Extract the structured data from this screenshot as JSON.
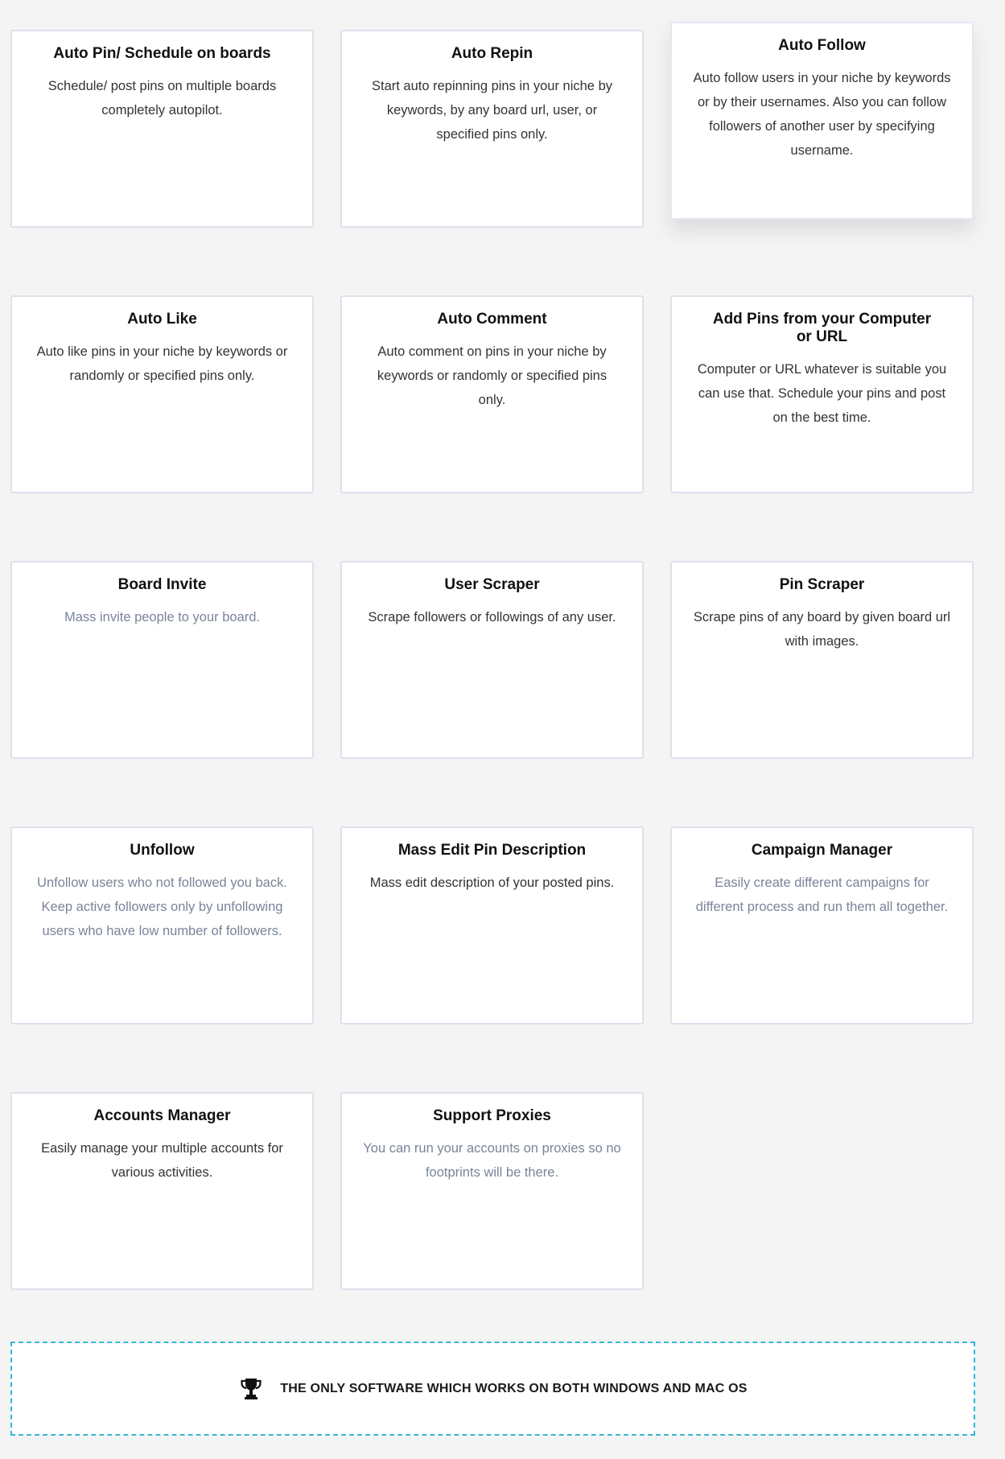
{
  "features": [
    {
      "title": "Auto Pin/ Schedule on boards",
      "description": "Schedule/ post pins on multiple boards completely autopilot."
    },
    {
      "title": "Auto Repin",
      "description": "Start auto repinning pins in your niche by keywords, by any board url, user, or specified pins only."
    },
    {
      "title": "Auto Follow",
      "description": "Auto follow users in your niche by keywords or by their usernames. Also you can follow followers of another user by specifying username."
    },
    {
      "title": "Auto Like",
      "description": "Auto like pins in your niche by keywords or randomly or specified pins only."
    },
    {
      "title": "Auto Comment",
      "description": "Auto comment on pins in your niche by keywords or randomly or specified pins only."
    },
    {
      "title": "Add Pins from your Computer or URL",
      "description": "Computer or URL whatever is suitable you can use that. Schedule your pins and post on the best time."
    },
    {
      "title": "Board Invite",
      "description": "Mass invite people to your board."
    },
    {
      "title": "User Scraper",
      "description": "Scrape followers or followings of any user."
    },
    {
      "title": "Pin Scraper",
      "description": "Scrape pins of any board by given board url with images."
    },
    {
      "title": "Unfollow",
      "description": "Unfollow users who not followed you back. Keep active followers only by unfollowing users who have low number of followers."
    },
    {
      "title": "Mass Edit Pin Description",
      "description": "Mass edit description of your posted pins."
    },
    {
      "title": "Campaign Manager",
      "description": "Easily create different campaigns for different process and run them all together."
    },
    {
      "title": "Accounts Manager",
      "description": "Easily manage your multiple accounts for various activities."
    },
    {
      "title": "Support Proxies",
      "description": "You can run your accounts on proxies so no footprints will be there."
    }
  ],
  "banner": {
    "icon": "trophy-icon",
    "text": "THE ONLY SOFTWARE WHICH WORKS ON BOTH WINDOWS AND MAC OS"
  },
  "colors": {
    "background": "#f4f4f5",
    "card_border": "#dde1ec",
    "muted_text": "#7a8499",
    "banner_border": "#36b4d9"
  }
}
